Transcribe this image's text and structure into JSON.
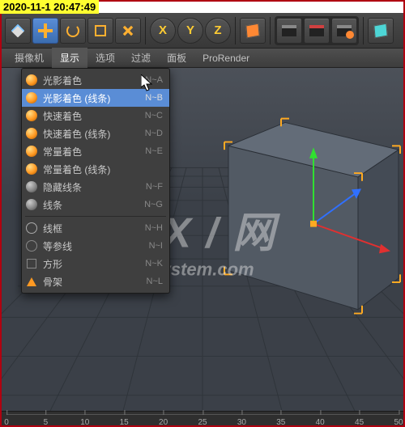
{
  "timestamp": "2020-11-1 20:47:49",
  "watermark": {
    "line1": "GX / 网",
    "line2": "system.com"
  },
  "toolbar": {
    "cursor": "cursor-tool",
    "move": "move-tool",
    "rotate": "rotate-tool",
    "scale": "scale-tool",
    "axes": [
      "X",
      "Y",
      "Z"
    ],
    "obj": "object-cube",
    "clap1": "take",
    "clap2": "take-red",
    "clap3": "take-settings",
    "prim": "cube-primitive"
  },
  "menubar": {
    "items": [
      {
        "id": "camera",
        "label": "摄像机"
      },
      {
        "id": "display",
        "label": "显示"
      },
      {
        "id": "options",
        "label": "选项"
      },
      {
        "id": "filter",
        "label": "过滤"
      },
      {
        "id": "panel",
        "label": "面板"
      },
      {
        "id": "prorender",
        "label": "ProRender"
      }
    ],
    "active": "display"
  },
  "dropdown": {
    "items": [
      {
        "id": "gouraud",
        "label": "光影着色",
        "shortcut": "N~A",
        "icon": "sphere"
      },
      {
        "id": "gouraud-lines",
        "label": "光影着色 (线条)",
        "shortcut": "N~B",
        "icon": "sphere",
        "highlight": true
      },
      {
        "id": "quick",
        "label": "快速着色",
        "shortcut": "N~C",
        "icon": "sphere"
      },
      {
        "id": "quick-lines",
        "label": "快速着色 (线条)",
        "shortcut": "N~D",
        "icon": "sphere"
      },
      {
        "id": "constant",
        "label": "常量着色",
        "shortcut": "N~E",
        "icon": "sphere"
      },
      {
        "id": "constant-lines",
        "label": "常量着色 (线条)",
        "shortcut": "",
        "icon": "sphere"
      },
      {
        "id": "hidden-line",
        "label": "隐藏线条",
        "shortcut": "N~F",
        "icon": "sphere-faded"
      },
      {
        "id": "lines",
        "label": "线条",
        "shortcut": "N~G",
        "icon": "sphere-faded"
      },
      {
        "sep": true
      },
      {
        "id": "wireframe",
        "label": "线框",
        "shortcut": "N~H",
        "icon": "wire"
      },
      {
        "id": "isoparm",
        "label": "等参线",
        "shortcut": "N~I",
        "icon": "circ"
      },
      {
        "id": "box",
        "label": "方形",
        "shortcut": "N~K",
        "icon": "square"
      },
      {
        "id": "skeleton",
        "label": "骨架",
        "shortcut": "N~L",
        "icon": "tri"
      }
    ]
  },
  "timeline": {
    "ticks": [
      "0",
      "5",
      "10",
      "15",
      "20",
      "25",
      "30",
      "35",
      "40",
      "45",
      "50"
    ]
  }
}
